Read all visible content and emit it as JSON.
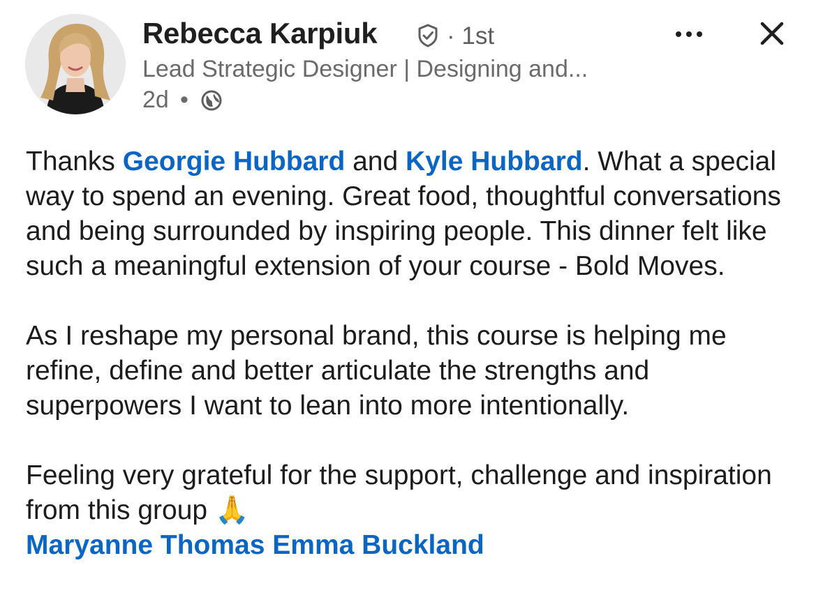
{
  "author": {
    "name": "Rebecca Karpiuk",
    "degree": "· 1st",
    "headline": "Lead Strategic Designer | Designing and...",
    "time": "2d",
    "separator": "•",
    "verified_icon": "verified-shield-icon",
    "visibility_icon": "globe-icon"
  },
  "actions": {
    "more_icon": "more-options-icon",
    "close_icon": "close-icon"
  },
  "post": {
    "p1": {
      "prefix": "Thanks ",
      "mention1": "Georgie Hubbard",
      "connector": " and ",
      "mention2": "Kyle Hubbard",
      "rest": ". What a special way to spend an evening.  Great food, thoughtful conversations and being surrounded by inspiring people. This dinner felt like such a meaningful extension of your course - Bold Moves."
    },
    "p2": "As I reshape my personal brand, this course is helping me refine, define and better articulate the strengths and superpowers I want to lean into more intentionally.",
    "p3": {
      "text": "Feeling very grateful for the support, challenge and inspiration from this group ",
      "emoji": "🙏"
    },
    "tags": [
      "Maryanne Thomas",
      "Emma Buckland"
    ]
  },
  "colors": {
    "link": "#0a66c2",
    "secondary_text": "#6a6a6a",
    "primary_text": "#1c1c1c"
  }
}
